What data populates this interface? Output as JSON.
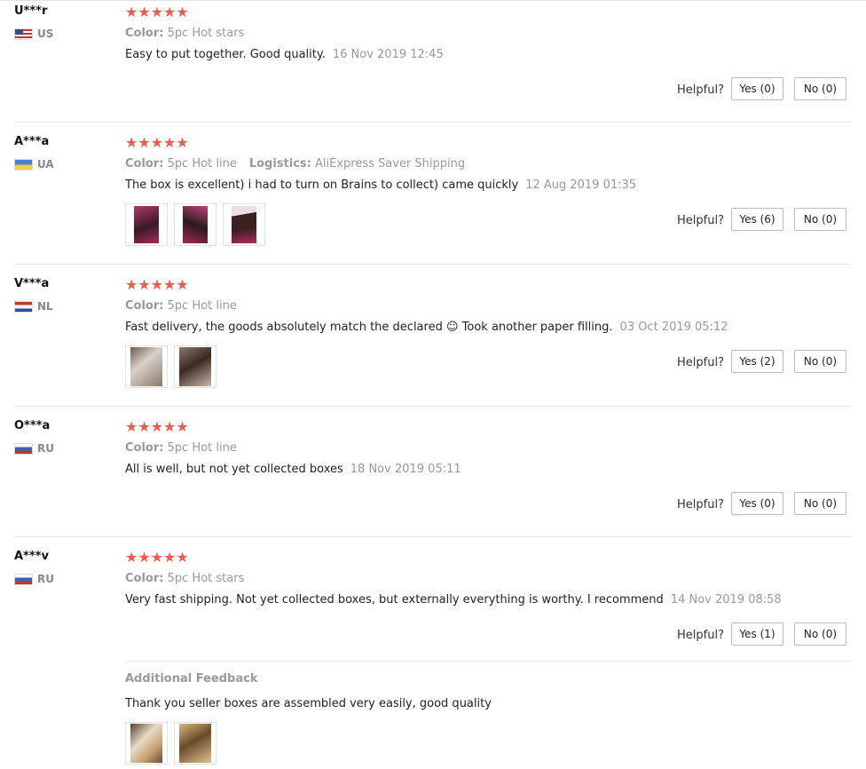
{
  "reviews": [
    {
      "user": "U***r",
      "country": "US",
      "stars": "★★★★★",
      "color_label": "Color:",
      "color_value": "5pc Hot stars",
      "logistics_label": "",
      "logistics_value": "",
      "text": "Easy to put together. Good quality.",
      "date": "16 Nov 2019 12:45",
      "helpful": "Helpful?",
      "yes": "Yes (0)",
      "no": "No (0)"
    },
    {
      "user": "A***a",
      "country": "UA",
      "stars": "★★★★★",
      "color_label": "Color:",
      "color_value": "5pc Hot line",
      "logistics_label": "Logistics:",
      "logistics_value": "AliExpress Saver Shipping",
      "text": "The box is excellent) i had to turn on Brains to collect) came quickly",
      "date": "12 Aug 2019 01:35",
      "helpful": "Helpful?",
      "yes": "Yes (6)",
      "no": "No (0)"
    },
    {
      "user": "V***a",
      "country": "NL",
      "stars": "★★★★★",
      "color_label": "Color:",
      "color_value": "5pc Hot line",
      "logistics_label": "",
      "logistics_value": "",
      "text": "Fast delivery, the goods absolutely match the declared ☺ Took another paper filling.",
      "date": "03 Oct 2019 05:12",
      "helpful": "Helpful?",
      "yes": "Yes (2)",
      "no": "No (0)"
    },
    {
      "user": "O***a",
      "country": "RU",
      "stars": "★★★★★",
      "color_label": "Color:",
      "color_value": "5pc Hot line",
      "logistics_label": "",
      "logistics_value": "",
      "text": "All is well, but not yet collected boxes",
      "date": "18 Nov 2019 05:11",
      "helpful": "Helpful?",
      "yes": "Yes (0)",
      "no": "No (0)"
    },
    {
      "user": "A***v",
      "country": "RU",
      "stars": "★★★★★",
      "color_label": "Color:",
      "color_value": "5pc Hot stars",
      "logistics_label": "",
      "logistics_value": "",
      "text": "Very fast shipping. Not yet collected boxes, but externally everything is worthy. I recommend",
      "date": "14 Nov 2019 08:58",
      "helpful": "Helpful?",
      "yes": "Yes (1)",
      "no": "No (0)",
      "additional_label": "Additional Feedback",
      "additional_text": "Thank you seller boxes are assembled very easily, good quality"
    }
  ],
  "colors": {
    "star": "#f25a4e",
    "muted": "#999999",
    "border": "#bbbbbb"
  }
}
